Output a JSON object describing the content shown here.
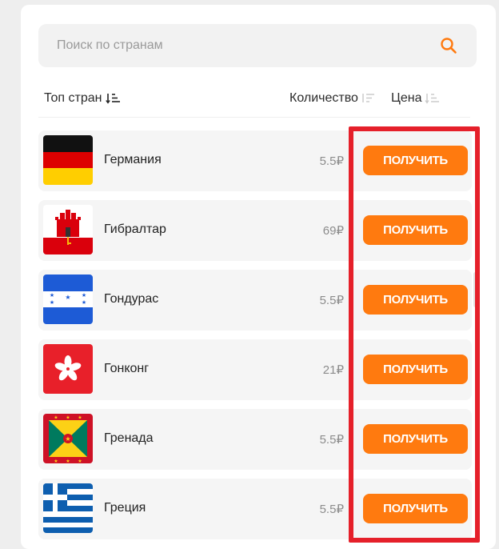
{
  "search": {
    "placeholder": "Поиск по странам"
  },
  "header": {
    "top_label": "Топ стран",
    "quantity_label": "Количество",
    "price_label": "Цена"
  },
  "rows": [
    {
      "country": "Германия",
      "price": "5.5₽",
      "button": "ПОЛУЧИТЬ",
      "flag": "germany-flag"
    },
    {
      "country": "Гибралтар",
      "price": "69₽",
      "button": "ПОЛУЧИТЬ",
      "flag": "gibraltar-flag"
    },
    {
      "country": "Гондурас",
      "price": "5.5₽",
      "button": "ПОЛУЧИТЬ",
      "flag": "honduras-flag"
    },
    {
      "country": "Гонконг",
      "price": "21₽",
      "button": "ПОЛУЧИТЬ",
      "flag": "hong-kong-flag"
    },
    {
      "country": "Гренада",
      "price": "5.5₽",
      "button": "ПОЛУЧИТЬ",
      "flag": "grenada-flag"
    },
    {
      "country": "Греция",
      "price": "5.5₽",
      "button": "ПОЛУЧИТЬ",
      "flag": "greece-flag"
    }
  ],
  "colors": {
    "accent": "#ff7a0f",
    "highlight": "#e5202a",
    "row_background": "#f5f5f5"
  }
}
